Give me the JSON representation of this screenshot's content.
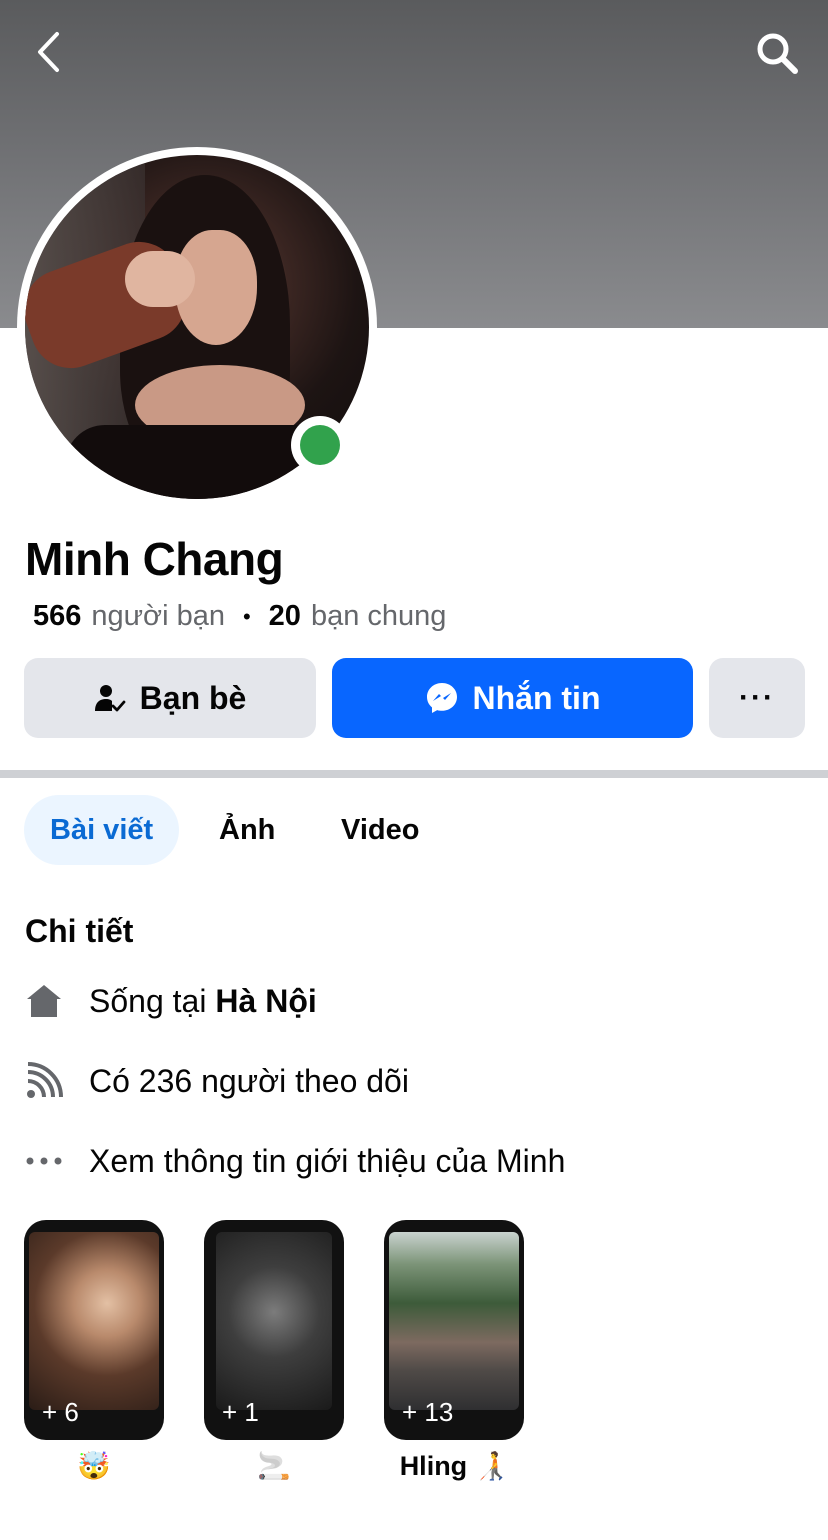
{
  "profile": {
    "name": "Minh Chang",
    "friends_count": "566",
    "friends_label": "người bạn",
    "mutual_count": "20",
    "mutual_label": "bạn chung",
    "online": true
  },
  "actions": {
    "friends_label": "Bạn bè",
    "message_label": "Nhắn tin",
    "more_label": "···"
  },
  "tabs": [
    {
      "label": "Bài viết",
      "active": true
    },
    {
      "label": "Ảnh",
      "active": false
    },
    {
      "label": "Video",
      "active": false
    }
  ],
  "details": {
    "title": "Chi tiết",
    "lives_prefix": "Sống tại",
    "lives_city": "Hà Nội",
    "followers": "Có 236 người theo dõi",
    "about": "Xem thông tin giới thiệu của Minh"
  },
  "highlights": [
    {
      "count": "+ 6",
      "label": "🤯"
    },
    {
      "count": "+ 1",
      "label": "🚬"
    },
    {
      "count": "+ 13",
      "label": "Hling 🧑‍🦯"
    }
  ],
  "colors": {
    "primary": "#0866ff",
    "online": "#31a24c",
    "tab_active_bg": "#ebf5ff",
    "tab_active_text": "#0a6ad3",
    "secondary_button": "#e4e6eb"
  },
  "icons": {
    "back": "chevron-left-icon",
    "search": "search-icon",
    "friends": "person-check-icon",
    "messenger": "messenger-icon",
    "home": "home-icon",
    "followers": "rss-icon",
    "more": "ellipsis-icon"
  }
}
